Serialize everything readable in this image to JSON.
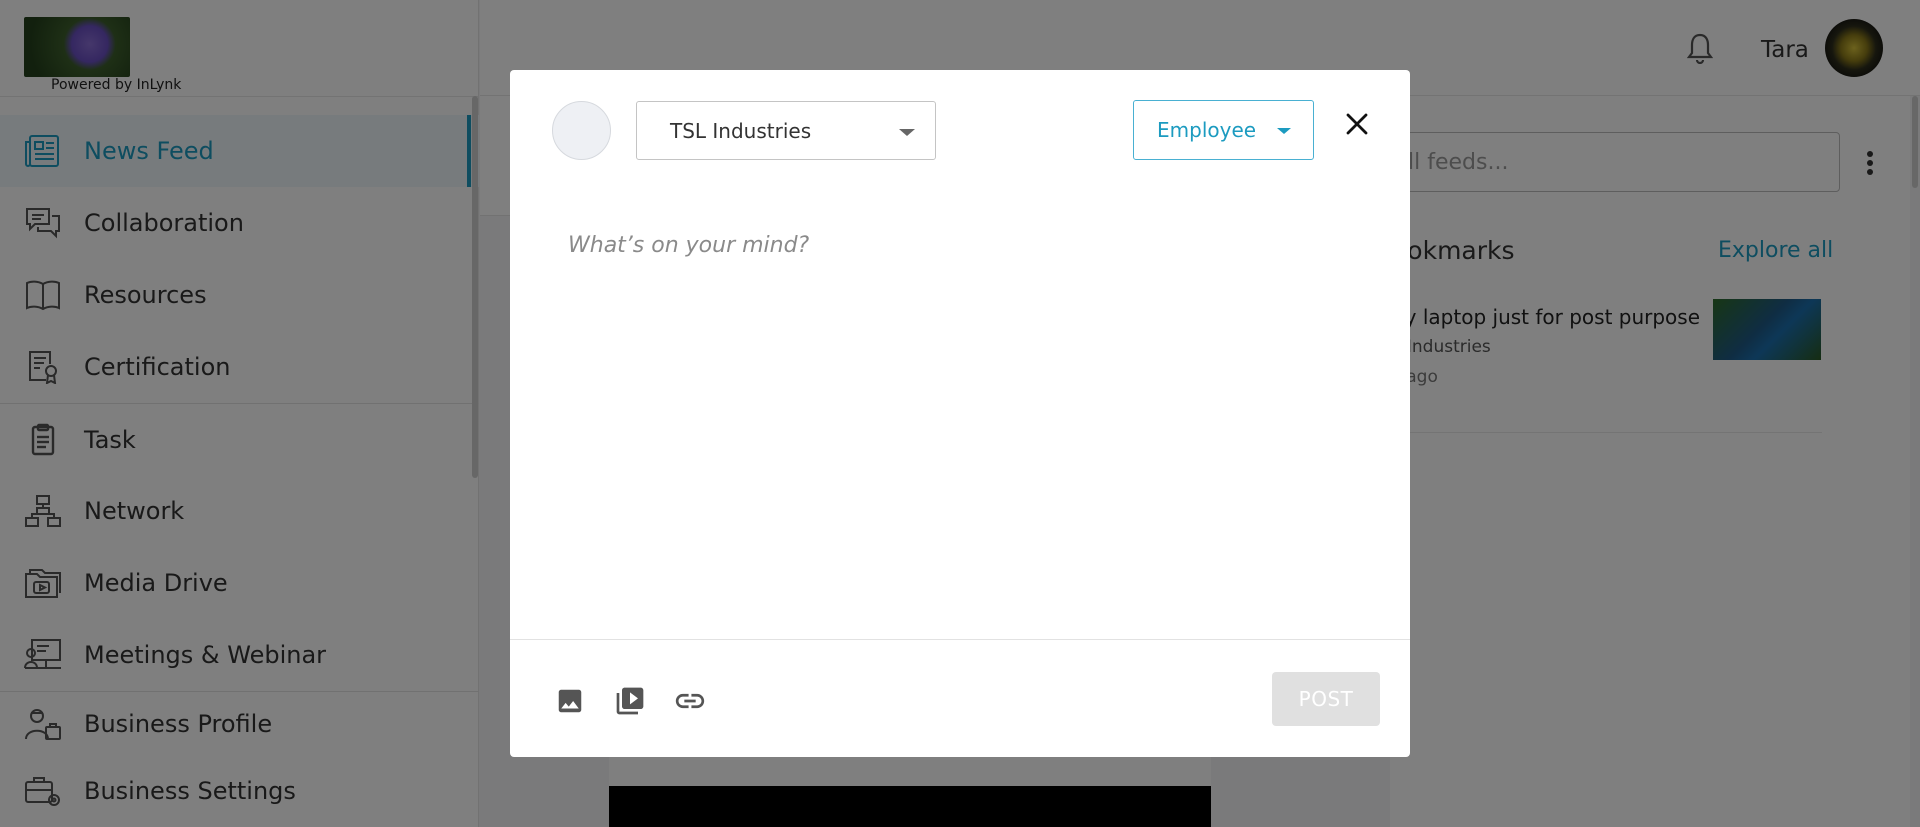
{
  "header": {
    "logo_alt": "WebsiteImage",
    "powered_by": "Powered by InLynk",
    "username": "Tara"
  },
  "sidebar": {
    "items": [
      {
        "label": "News Feed",
        "icon": "news-feed-icon",
        "active": true
      },
      {
        "label": "Collaboration",
        "icon": "chat-bubbles-icon"
      },
      {
        "label": "Resources",
        "icon": "book-icon"
      },
      {
        "label": "Certification",
        "icon": "certificate-icon"
      },
      {
        "label": "Task",
        "icon": "clipboard-icon"
      },
      {
        "label": "Network",
        "icon": "network-icon"
      },
      {
        "label": "Media Drive",
        "icon": "media-folder-icon"
      },
      {
        "label": "Meetings & Webinar",
        "icon": "webinar-icon"
      },
      {
        "label": "Business Profile",
        "icon": "business-profile-icon"
      },
      {
        "label": "Business Settings",
        "icon": "business-settings-icon"
      }
    ]
  },
  "right_panel": {
    "search_placeholder": "ll feeds...",
    "bookmarks_title": "ookmarks",
    "explore_all": "Explore all",
    "bookmark": {
      "title": "ny laptop just for post purpose",
      "org": "L Industries",
      "time": "s ago",
      "link": "e"
    }
  },
  "modal": {
    "org_select": "TSL Industries",
    "audience_select": "Employee",
    "placeholder": "What’s on your mind?",
    "post_label": "POST",
    "tools": [
      "image-icon",
      "video-library-icon",
      "link-icon"
    ]
  },
  "colors": {
    "accent": "#1c9bc0",
    "overlay": "rgba(0,0,0,0.5)",
    "post_disabled": "#e0e0e0"
  }
}
